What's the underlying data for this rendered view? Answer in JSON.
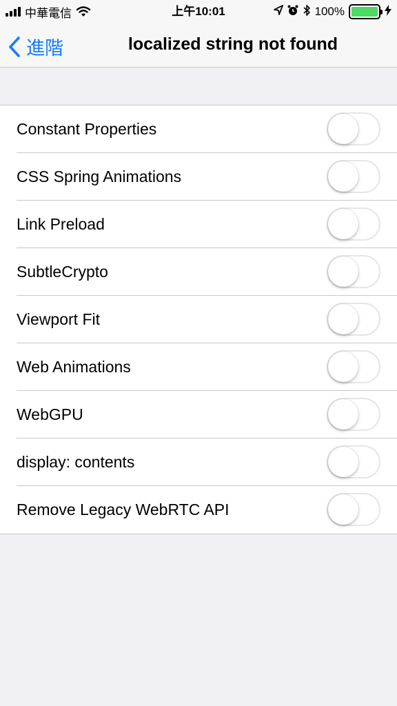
{
  "status_bar": {
    "carrier": "中華電信",
    "time": "上午10:01",
    "battery_percent": "100%",
    "battery_level": 1.0,
    "icons": [
      "signal-icon",
      "wifi-icon",
      "location-icon",
      "alarm-icon",
      "bluetooth-icon",
      "battery-icon",
      "charging-icon"
    ]
  },
  "nav": {
    "back_label": "進階",
    "title": "localized string not found"
  },
  "colors": {
    "accent": "#157efb",
    "background": "#efeff4",
    "separator": "#c8c7cc",
    "toggle_on": "#4cd964"
  },
  "features": [
    {
      "label": "Constant Properties",
      "enabled": false
    },
    {
      "label": "CSS Spring Animations",
      "enabled": false
    },
    {
      "label": "Link Preload",
      "enabled": false
    },
    {
      "label": "SubtleCrypto",
      "enabled": false
    },
    {
      "label": "Viewport Fit",
      "enabled": false
    },
    {
      "label": "Web Animations",
      "enabled": false
    },
    {
      "label": "WebGPU",
      "enabled": false
    },
    {
      "label": "display: contents",
      "enabled": false
    },
    {
      "label": "Remove Legacy WebRTC API",
      "enabled": false
    }
  ]
}
